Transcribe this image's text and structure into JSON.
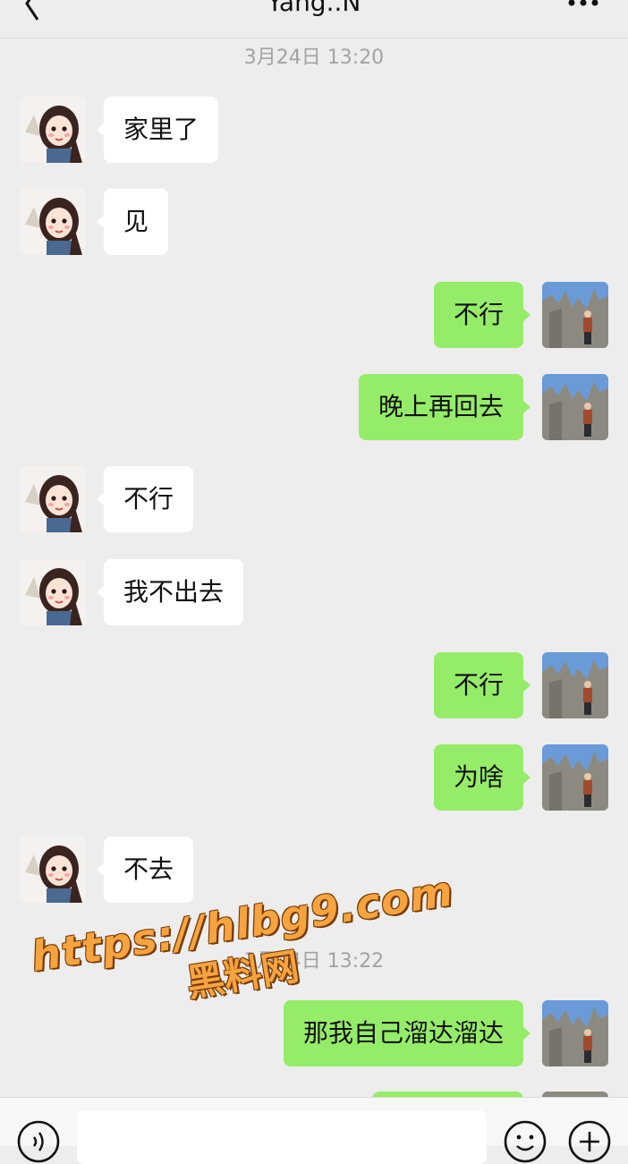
{
  "header": {
    "title": "Yang..N"
  },
  "timestamps": [
    "3月24日 13:20",
    "3月24日 13:22"
  ],
  "messages": [
    {
      "from": "contact",
      "text": "家里了"
    },
    {
      "from": "contact",
      "text": "见"
    },
    {
      "from": "me",
      "text": "不行"
    },
    {
      "from": "me",
      "text": "晚上再回去"
    },
    {
      "from": "contact",
      "text": "不行"
    },
    {
      "from": "contact",
      "text": "我不出去"
    },
    {
      "from": "me",
      "text": "不行"
    },
    {
      "from": "me",
      "text": "为啥"
    },
    {
      "from": "contact",
      "text": "不去"
    },
    {
      "from": "me",
      "text": "那我自己溜达溜达"
    }
  ],
  "watermark": {
    "line1": "https://hlbg9.com",
    "line2": "黑料网"
  },
  "colors": {
    "background": "#ededed",
    "outgoing_bubble": "#95ec69",
    "incoming_bubble": "#ffffff",
    "watermark": "#f6a440"
  },
  "icons": {
    "back": "chevron-left-icon",
    "more": "more-dots-icon",
    "voice": "voice-icon",
    "emoji": "emoji-icon",
    "plus": "plus-icon"
  }
}
